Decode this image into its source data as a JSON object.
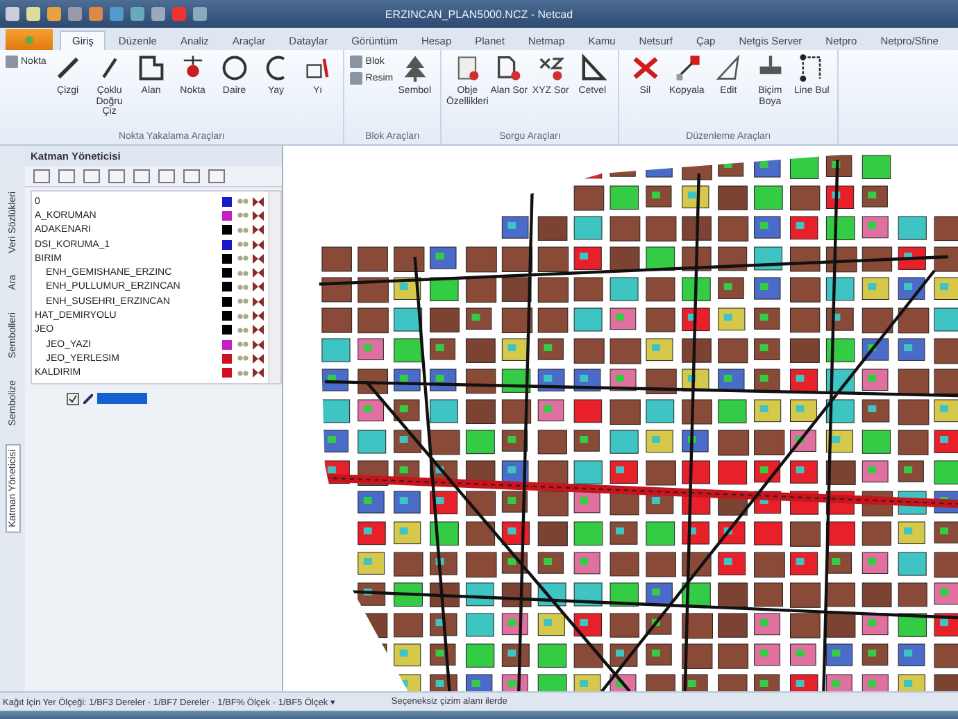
{
  "window": {
    "title": "ERZINCAN_PLAN5000.NCZ - Netcad"
  },
  "ribbon_tabs": [
    {
      "label": "Giriş",
      "selected": true
    },
    {
      "label": "Düzenle",
      "selected": false
    },
    {
      "label": "Analiz",
      "selected": false
    },
    {
      "label": "Araçlar",
      "selected": false
    },
    {
      "label": "Dataylar",
      "selected": false
    },
    {
      "label": "Görüntüm",
      "selected": false
    },
    {
      "label": "Hesap",
      "selected": false
    },
    {
      "label": "Planet",
      "selected": false
    },
    {
      "label": "Netmap",
      "selected": false
    },
    {
      "label": "Kamu",
      "selected": false
    },
    {
      "label": "Netsurf",
      "selected": false
    },
    {
      "label": "Çap",
      "selected": false
    },
    {
      "label": "Netgis Server",
      "selected": false
    },
    {
      "label": "Netpro",
      "selected": false
    },
    {
      "label": "Netpro/Sfine",
      "selected": false
    }
  ],
  "ribbon_groups": [
    {
      "title": "Nokta Yakalama Araçları",
      "small_buttons": [
        "Nokta"
      ],
      "buttons": [
        "Çizgi",
        "Çoklu Doğru Çiz",
        "Alan",
        "Nokta",
        "Daire",
        "Yay",
        "Yı"
      ]
    },
    {
      "title": "Blok Araçları",
      "small_buttons": [
        "Blok",
        "Resim"
      ],
      "buttons": [
        "Sembol"
      ]
    },
    {
      "title": "Sorgu Araçları",
      "buttons": [
        "Obje Özellikleri",
        "Alan Sor",
        "XYZ Sor",
        "Cetvel"
      ]
    },
    {
      "title": "Düzenleme Araçları",
      "buttons": [
        "Sil",
        "Kopyala",
        "Edit",
        "Biçim Boya",
        "Line Bul"
      ]
    }
  ],
  "layer_panel": {
    "title": "Katman Yöneticisi",
    "layers": [
      {
        "name": "0",
        "color": "#1a1ac8"
      },
      {
        "name": "A_KORUMAN",
        "color": "#c81ec8"
      },
      {
        "name": "ADAKENARI",
        "color": "#000000"
      },
      {
        "name": "DSI_KORUMA_1",
        "color": "#1a1ac8"
      },
      {
        "name": "BIRIM",
        "color": "#000000",
        "children": [
          {
            "name": "ENH_GEMISHANE_ERZINC",
            "color": "#000000"
          },
          {
            "name": "ENH_PULLUMUR_ERZINCAN",
            "color": "#000000"
          },
          {
            "name": "ENH_SUSEHRI_ERZINCAN",
            "color": "#000000"
          }
        ]
      },
      {
        "name": "HAT_DEMIRYOLU",
        "color": "#000000"
      },
      {
        "name": "JEO",
        "color": "#000000",
        "children": [
          {
            "name": "JEO_YAZI",
            "color": "#c81ec8"
          },
          {
            "name": "JEO_YERLESIM",
            "color": "#d01020"
          }
        ]
      },
      {
        "name": "KALDIRIM",
        "color": "#d01020"
      }
    ],
    "selected_layer": {
      "checked": true
    },
    "side_tabs": [
      {
        "label": "Veri Sözlükleri",
        "selected": false
      },
      {
        "label": "Ara",
        "selected": false
      },
      {
        "label": "Sembolleri",
        "selected": false
      },
      {
        "label": "Sembolize",
        "selected": false
      },
      {
        "label": "Katman Yöneticisi",
        "selected": true
      }
    ]
  },
  "status_bar": {
    "scale": "Kağıt İçin Yer Ölçeği: 1/BF3 Dereler · 1/BF7 Dereler · 1/BF% Ölçek · 1/BF5 Ölçek ▾",
    "message": "Seçeneksiz çizim alanı ilerde"
  }
}
